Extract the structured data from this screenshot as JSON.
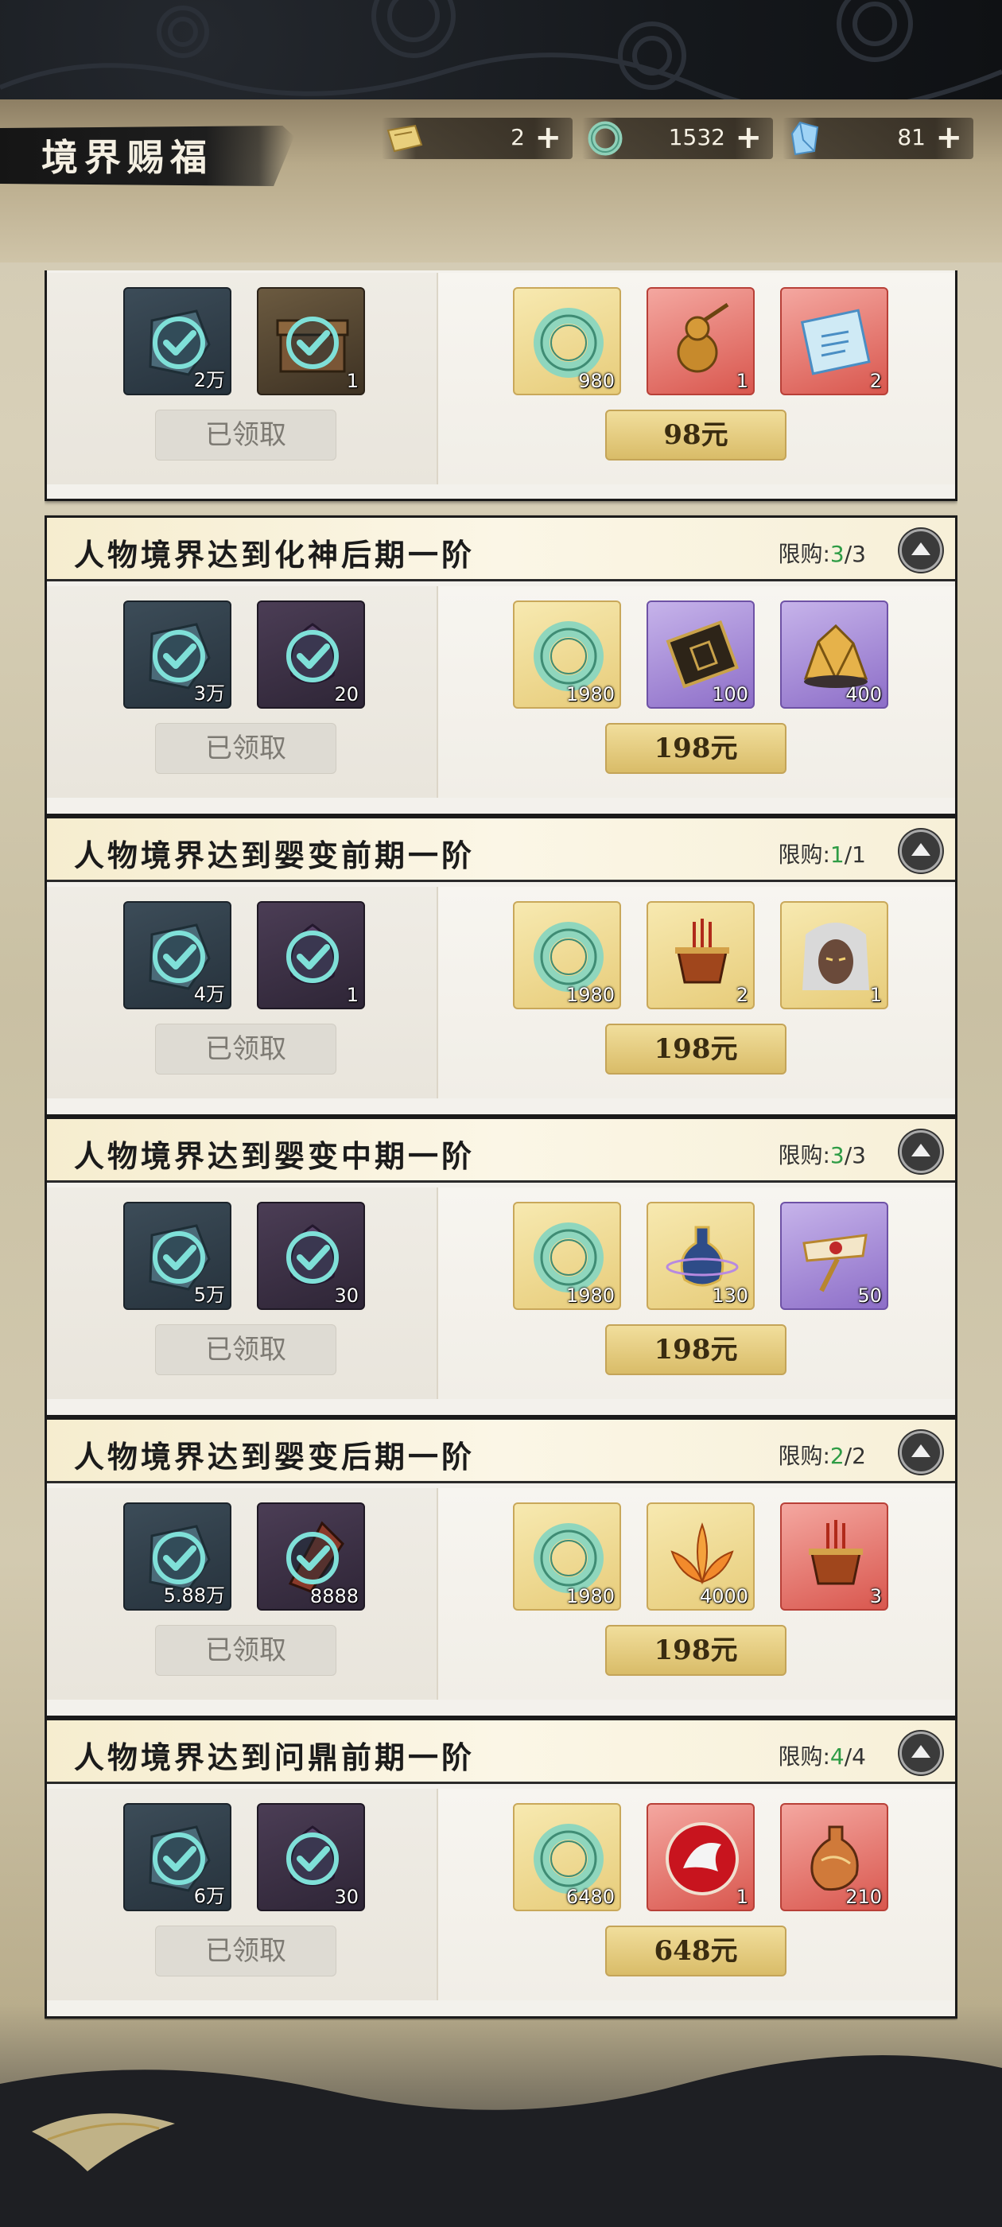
{
  "title": "境界赐福",
  "currencies": [
    {
      "icon": "gold-ticket-icon",
      "value": "2"
    },
    {
      "icon": "jade-ring-icon",
      "value": "1532"
    },
    {
      "icon": "spirit-crystal-icon",
      "value": "81"
    }
  ],
  "plus_label": "+",
  "claimed_label": "已领取",
  "cards": [
    {
      "title": "",
      "limit_current": "",
      "limit_total": "",
      "free_items": [
        {
          "icon": "slate-stone-icon",
          "qty": "2万",
          "style": "slate"
        },
        {
          "icon": "wood-chest-icon",
          "qty": "1",
          "style": "brown"
        }
      ],
      "paid_items": [
        {
          "icon": "jade-ring-icon",
          "qty": "980",
          "style": "gold"
        },
        {
          "icon": "gourd-icon",
          "qty": "1",
          "style": "red"
        },
        {
          "icon": "scroll-icon",
          "qty": "2",
          "style": "red"
        }
      ],
      "price": "98元"
    },
    {
      "title": "人物境界达到化神后期一阶",
      "limit_label": "限购:",
      "limit_current": "3",
      "limit_total": "/3",
      "free_items": [
        {
          "icon": "slate-stone-icon",
          "qty": "3万",
          "style": "slate"
        },
        {
          "icon": "spirit-herb-icon",
          "qty": "20",
          "style": "plum"
        }
      ],
      "paid_items": [
        {
          "icon": "jade-ring-icon",
          "qty": "1980",
          "style": "gold"
        },
        {
          "icon": "token-plaque-icon",
          "qty": "100",
          "style": "purple"
        },
        {
          "icon": "gold-ore-icon",
          "qty": "400",
          "style": "purple"
        }
      ],
      "price": "198元"
    },
    {
      "title": "人物境界达到婴变前期一阶",
      "limit_label": "限购:",
      "limit_current": "1",
      "limit_total": "/1",
      "free_items": [
        {
          "icon": "slate-stone-icon",
          "qty": "4万",
          "style": "slate"
        },
        {
          "icon": "spirit-herb-icon",
          "qty": "1",
          "style": "plum"
        }
      ],
      "paid_items": [
        {
          "icon": "jade-ring-icon",
          "qty": "1980",
          "style": "gold"
        },
        {
          "icon": "incense-burner-icon",
          "qty": "2",
          "style": "gold"
        },
        {
          "icon": "character-portrait-icon",
          "qty": "1",
          "style": "gold"
        }
      ],
      "price": "198元"
    },
    {
      "title": "人物境界达到婴变中期一阶",
      "limit_label": "限购:",
      "limit_current": "3",
      "limit_total": "/3",
      "free_items": [
        {
          "icon": "slate-stone-icon",
          "qty": "5万",
          "style": "slate"
        },
        {
          "icon": "spirit-herb-icon",
          "qty": "30",
          "style": "plum"
        }
      ],
      "paid_items": [
        {
          "icon": "jade-ring-icon",
          "qty": "1980",
          "style": "gold"
        },
        {
          "icon": "elixir-vase-icon",
          "qty": "130",
          "style": "gold"
        },
        {
          "icon": "ornate-scepter-icon",
          "qty": "50",
          "style": "purple"
        }
      ],
      "price": "198元"
    },
    {
      "title": "人物境界达到婴变后期一阶",
      "limit_label": "限购:",
      "limit_current": "2",
      "limit_total": "/2",
      "free_items": [
        {
          "icon": "slate-stone-icon",
          "qty": "5.88万",
          "style": "slate"
        },
        {
          "icon": "red-shard-icon",
          "qty": "8888",
          "style": "plum"
        }
      ],
      "paid_items": [
        {
          "icon": "jade-ring-icon",
          "qty": "1980",
          "style": "gold"
        },
        {
          "icon": "fire-lotus-icon",
          "qty": "4000",
          "style": "gold"
        },
        {
          "icon": "incense-burner-icon",
          "qty": "3",
          "style": "red"
        }
      ],
      "price": "198元"
    },
    {
      "title": "人物境界达到问鼎前期一阶",
      "limit_label": "限购:",
      "limit_current": "4",
      "limit_total": "/4",
      "free_items": [
        {
          "icon": "slate-stone-icon",
          "qty": "6万",
          "style": "slate"
        },
        {
          "icon": "spirit-herb-icon",
          "qty": "30",
          "style": "plum"
        }
      ],
      "paid_items": [
        {
          "icon": "jade-ring-icon",
          "qty": "6480",
          "style": "gold"
        },
        {
          "icon": "white-dragon-badge-icon",
          "qty": "1",
          "style": "red"
        },
        {
          "icon": "elixir-bottle-icon",
          "qty": "210",
          "style": "red"
        }
      ],
      "price": "648元"
    }
  ]
}
